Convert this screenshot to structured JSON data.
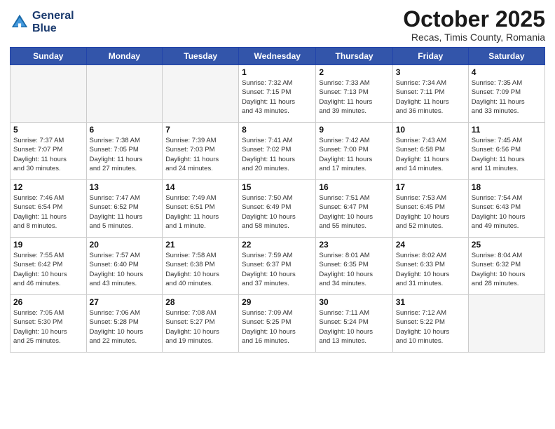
{
  "logo": {
    "line1": "General",
    "line2": "Blue"
  },
  "title": "October 2025",
  "subtitle": "Recas, Timis County, Romania",
  "days_of_week": [
    "Sunday",
    "Monday",
    "Tuesday",
    "Wednesday",
    "Thursday",
    "Friday",
    "Saturday"
  ],
  "weeks": [
    [
      {
        "day": "",
        "info": "",
        "empty": true
      },
      {
        "day": "",
        "info": "",
        "empty": true
      },
      {
        "day": "",
        "info": "",
        "empty": true
      },
      {
        "day": "1",
        "info": "Sunrise: 7:32 AM\nSunset: 7:15 PM\nDaylight: 11 hours\nand 43 minutes."
      },
      {
        "day": "2",
        "info": "Sunrise: 7:33 AM\nSunset: 7:13 PM\nDaylight: 11 hours\nand 39 minutes."
      },
      {
        "day": "3",
        "info": "Sunrise: 7:34 AM\nSunset: 7:11 PM\nDaylight: 11 hours\nand 36 minutes."
      },
      {
        "day": "4",
        "info": "Sunrise: 7:35 AM\nSunset: 7:09 PM\nDaylight: 11 hours\nand 33 minutes."
      }
    ],
    [
      {
        "day": "5",
        "info": "Sunrise: 7:37 AM\nSunset: 7:07 PM\nDaylight: 11 hours\nand 30 minutes."
      },
      {
        "day": "6",
        "info": "Sunrise: 7:38 AM\nSunset: 7:05 PM\nDaylight: 11 hours\nand 27 minutes."
      },
      {
        "day": "7",
        "info": "Sunrise: 7:39 AM\nSunset: 7:03 PM\nDaylight: 11 hours\nand 24 minutes."
      },
      {
        "day": "8",
        "info": "Sunrise: 7:41 AM\nSunset: 7:02 PM\nDaylight: 11 hours\nand 20 minutes."
      },
      {
        "day": "9",
        "info": "Sunrise: 7:42 AM\nSunset: 7:00 PM\nDaylight: 11 hours\nand 17 minutes."
      },
      {
        "day": "10",
        "info": "Sunrise: 7:43 AM\nSunset: 6:58 PM\nDaylight: 11 hours\nand 14 minutes."
      },
      {
        "day": "11",
        "info": "Sunrise: 7:45 AM\nSunset: 6:56 PM\nDaylight: 11 hours\nand 11 minutes."
      }
    ],
    [
      {
        "day": "12",
        "info": "Sunrise: 7:46 AM\nSunset: 6:54 PM\nDaylight: 11 hours\nand 8 minutes."
      },
      {
        "day": "13",
        "info": "Sunrise: 7:47 AM\nSunset: 6:52 PM\nDaylight: 11 hours\nand 5 minutes."
      },
      {
        "day": "14",
        "info": "Sunrise: 7:49 AM\nSunset: 6:51 PM\nDaylight: 11 hours\nand 1 minute."
      },
      {
        "day": "15",
        "info": "Sunrise: 7:50 AM\nSunset: 6:49 PM\nDaylight: 10 hours\nand 58 minutes."
      },
      {
        "day": "16",
        "info": "Sunrise: 7:51 AM\nSunset: 6:47 PM\nDaylight: 10 hours\nand 55 minutes."
      },
      {
        "day": "17",
        "info": "Sunrise: 7:53 AM\nSunset: 6:45 PM\nDaylight: 10 hours\nand 52 minutes."
      },
      {
        "day": "18",
        "info": "Sunrise: 7:54 AM\nSunset: 6:43 PM\nDaylight: 10 hours\nand 49 minutes."
      }
    ],
    [
      {
        "day": "19",
        "info": "Sunrise: 7:55 AM\nSunset: 6:42 PM\nDaylight: 10 hours\nand 46 minutes."
      },
      {
        "day": "20",
        "info": "Sunrise: 7:57 AM\nSunset: 6:40 PM\nDaylight: 10 hours\nand 43 minutes."
      },
      {
        "day": "21",
        "info": "Sunrise: 7:58 AM\nSunset: 6:38 PM\nDaylight: 10 hours\nand 40 minutes."
      },
      {
        "day": "22",
        "info": "Sunrise: 7:59 AM\nSunset: 6:37 PM\nDaylight: 10 hours\nand 37 minutes."
      },
      {
        "day": "23",
        "info": "Sunrise: 8:01 AM\nSunset: 6:35 PM\nDaylight: 10 hours\nand 34 minutes."
      },
      {
        "day": "24",
        "info": "Sunrise: 8:02 AM\nSunset: 6:33 PM\nDaylight: 10 hours\nand 31 minutes."
      },
      {
        "day": "25",
        "info": "Sunrise: 8:04 AM\nSunset: 6:32 PM\nDaylight: 10 hours\nand 28 minutes."
      }
    ],
    [
      {
        "day": "26",
        "info": "Sunrise: 7:05 AM\nSunset: 5:30 PM\nDaylight: 10 hours\nand 25 minutes."
      },
      {
        "day": "27",
        "info": "Sunrise: 7:06 AM\nSunset: 5:28 PM\nDaylight: 10 hours\nand 22 minutes."
      },
      {
        "day": "28",
        "info": "Sunrise: 7:08 AM\nSunset: 5:27 PM\nDaylight: 10 hours\nand 19 minutes."
      },
      {
        "day": "29",
        "info": "Sunrise: 7:09 AM\nSunset: 5:25 PM\nDaylight: 10 hours\nand 16 minutes."
      },
      {
        "day": "30",
        "info": "Sunrise: 7:11 AM\nSunset: 5:24 PM\nDaylight: 10 hours\nand 13 minutes."
      },
      {
        "day": "31",
        "info": "Sunrise: 7:12 AM\nSunset: 5:22 PM\nDaylight: 10 hours\nand 10 minutes."
      },
      {
        "day": "",
        "info": "",
        "empty": true,
        "shaded": true
      }
    ]
  ]
}
